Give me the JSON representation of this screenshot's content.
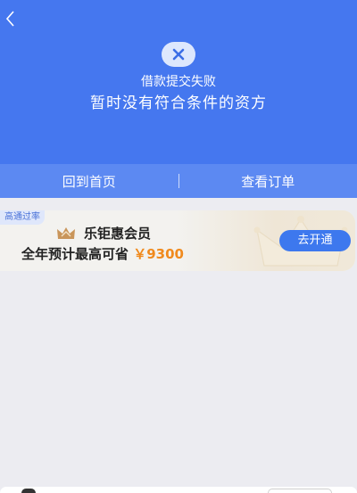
{
  "header": {
    "back_icon": "chevron-left-icon",
    "status_icon": "close-icon",
    "status_title": "借款提交失败",
    "status_reason": "暂时没有符合条件的资方"
  },
  "actions": {
    "home_label": "回到首页",
    "orders_label": "查看订单"
  },
  "promo": {
    "badge": "高通过率",
    "brand_icon": "crown-icon",
    "brand_name": "乐钜惠会员",
    "saving_prefix": "全年预计最高可省",
    "saving_amount": "￥9300",
    "cta_label": "去开通"
  },
  "colors": {
    "primary": "#4577ef",
    "action_bar": "#5c89f2",
    "accent_amount": "#f08a1d",
    "cta": "#3d78ee",
    "background": "#ececf1"
  }
}
